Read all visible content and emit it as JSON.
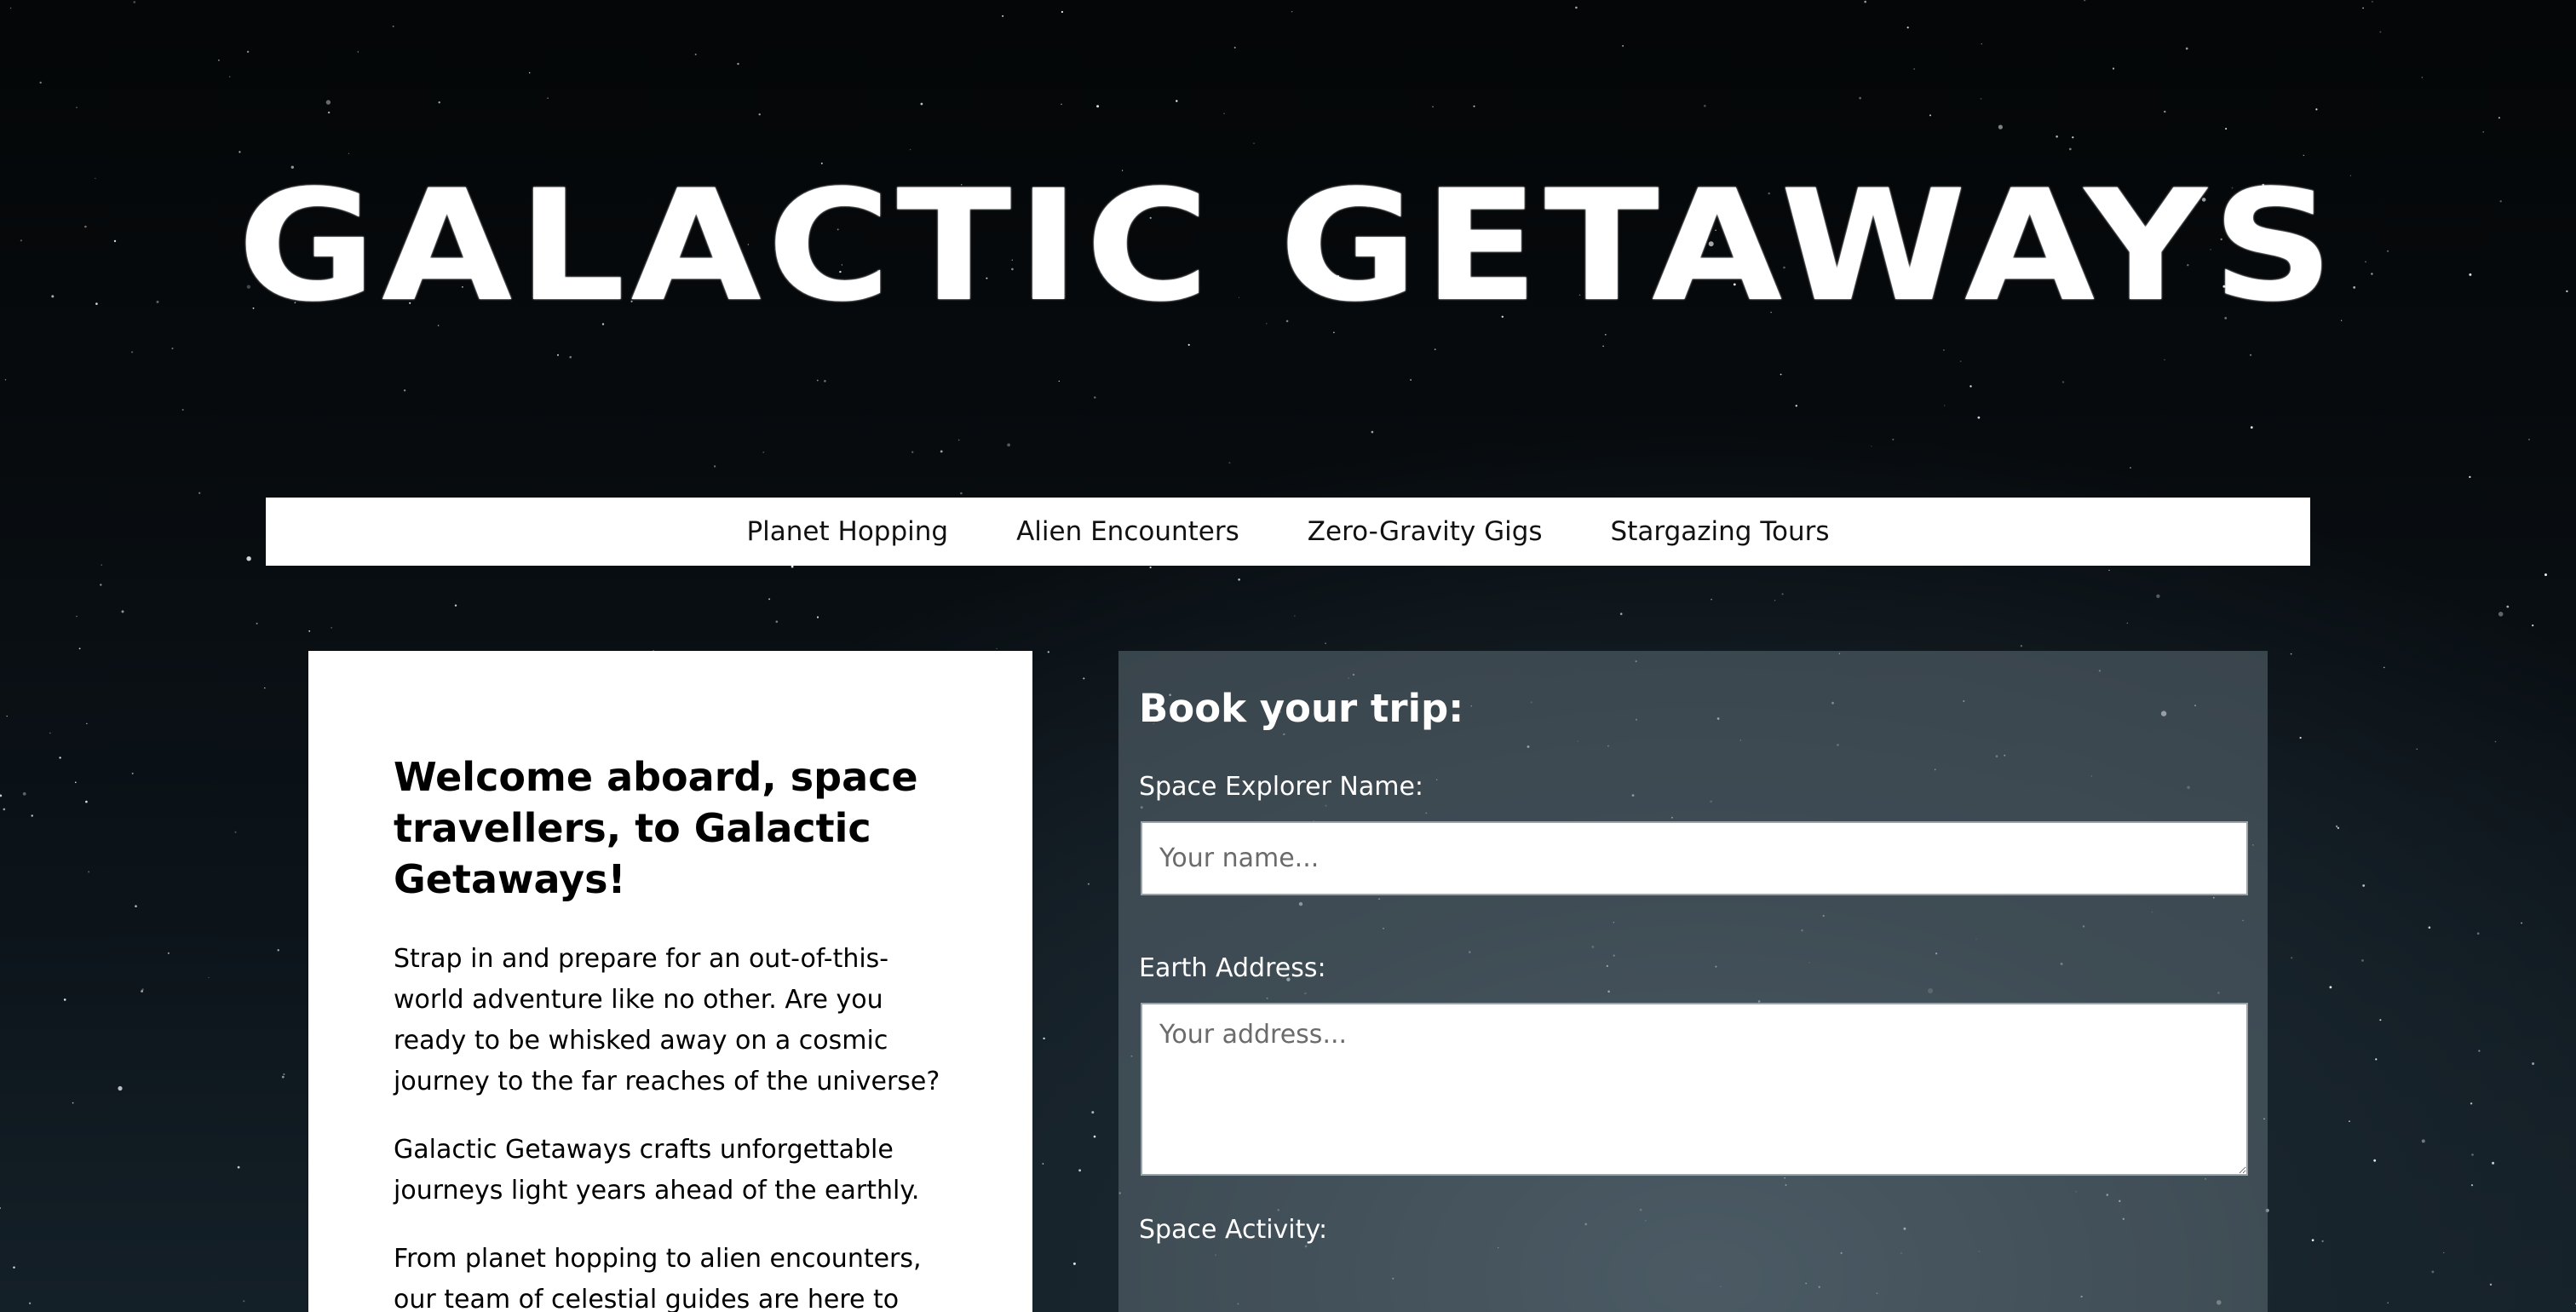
{
  "header": {
    "title": "GALACTIC GETAWAYS"
  },
  "nav": {
    "items": [
      {
        "label": "Planet Hopping"
      },
      {
        "label": "Alien Encounters"
      },
      {
        "label": "Zero-Gravity Gigs"
      },
      {
        "label": "Stargazing Tours"
      }
    ]
  },
  "welcome": {
    "heading": "Welcome aboard, space travellers, to Galactic Getaways!",
    "paragraphs": [
      "Strap in and prepare for an out-of-this-world adventure like no other. Are you ready to be whisked away on a cosmic journey to the far reaches of the universe?",
      "Galactic Getaways crafts unforgettable journeys light years ahead of the earthly.",
      "From planet hopping to alien encounters, our team of celestial guides are here to"
    ]
  },
  "booking": {
    "heading": "Book your trip:",
    "name_label": "Space Explorer Name:",
    "name_placeholder": "Your name...",
    "address_label": "Earth Address:",
    "address_placeholder": "Your address...",
    "activity_label": "Space Activity:"
  },
  "colors": {
    "background": "#070b0e",
    "nav_background": "#ffffff",
    "card_background": "#ffffff",
    "panel_background": "#5f6e76",
    "text_light": "#ffffff",
    "text_dark": "#000000"
  }
}
